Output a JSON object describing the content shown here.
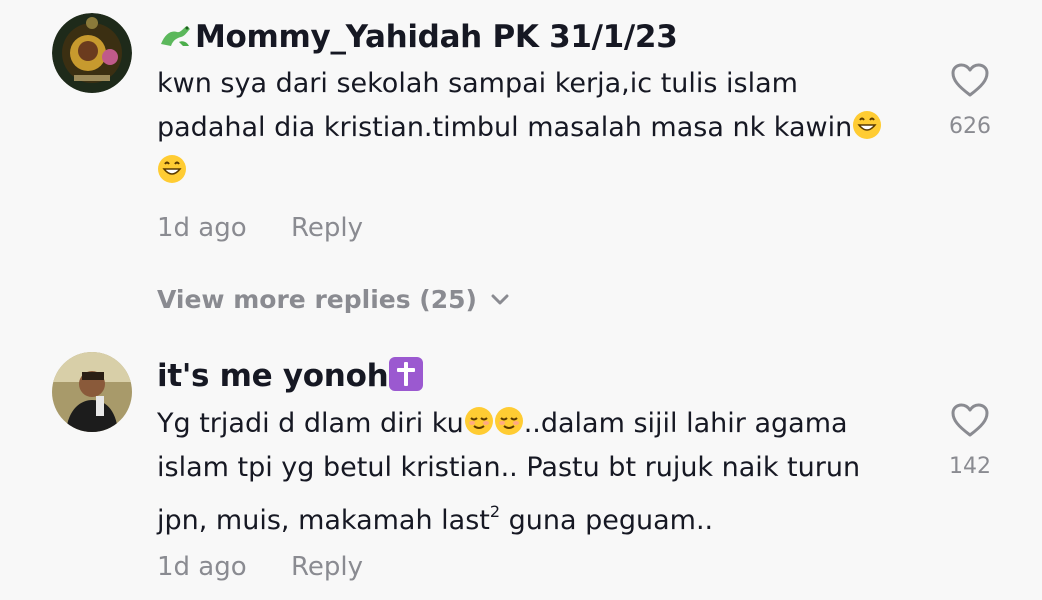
{
  "comments": [
    {
      "username": "Mommy_Yahidah PK 31/1/23",
      "username_prefix_icon": "dragon-emoji",
      "lines": [
        "kwn sya dari sekolah sampai kerja,ic tulis islam",
        "padahal dia kristian.timbul masalah masa nk kawin"
      ],
      "trailing_emojis": [
        "grinning-face-emoji",
        "grinning-face-emoji"
      ],
      "time": "1d ago",
      "reply_label": "Reply",
      "likes": "626",
      "view_more": "View more replies (25)"
    },
    {
      "username": "it's me yonoh",
      "username_suffix_icon": "latin-cross-emoji",
      "line1_a": "Yg trjadi d dlam diri ku",
      "line1_b": "..dalam sijil lahir agama",
      "line2": "islam tpi yg betul kristian.. Pastu bt rujuk naik turun",
      "line3_a": "jpn, muis, makamah last",
      "line3_sup": "2",
      "line3_b": " guna peguam..",
      "inline_emojis": [
        "relieved-face-emoji",
        "relieved-face-emoji"
      ],
      "time": "1d ago",
      "reply_label": "Reply",
      "likes": "142"
    }
  ],
  "colors": {
    "background": "#f8f8f8",
    "text_primary": "#161823",
    "text_secondary": "#8a8b91",
    "badge_purple": "#9b59d0",
    "emoji_yellow": "#ffcc33"
  }
}
